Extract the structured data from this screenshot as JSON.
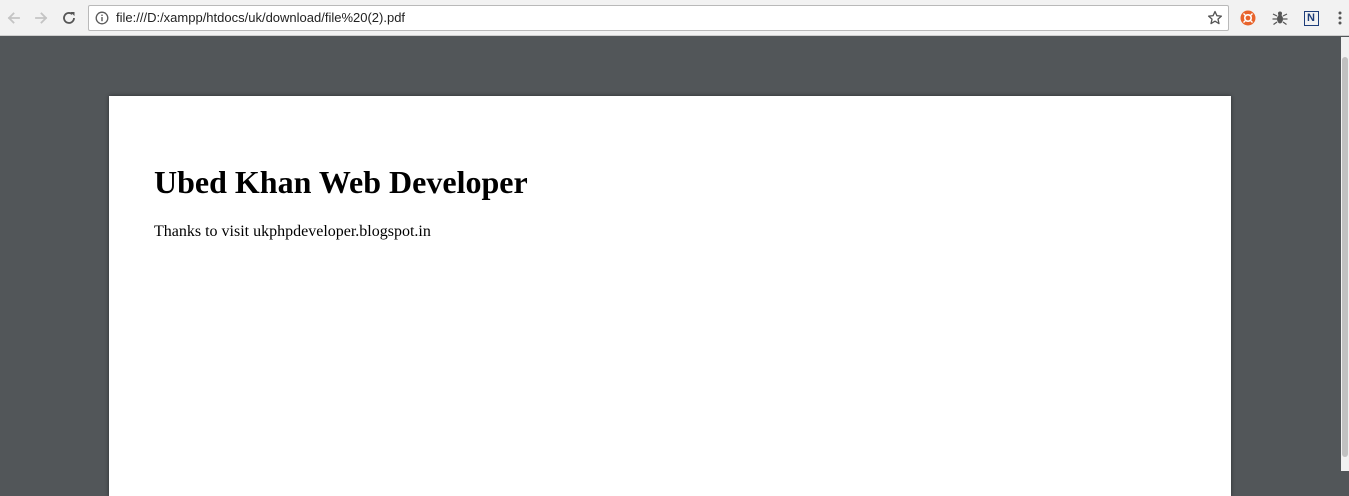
{
  "browser": {
    "url": "file:///D:/xampp/htdocs/uk/download/file%20(2).pdf",
    "icons": {
      "back": "arrow-left-icon",
      "forward": "arrow-right-icon",
      "reload": "reload-icon",
      "site_info": "info-icon",
      "bookmark": "star-icon",
      "extension_1": "orange-extension-icon",
      "extension_2": "bug-extension-icon",
      "extension_3": "n-extension-icon",
      "menu": "kebab-menu-icon"
    },
    "extension_3_label": "N"
  },
  "document": {
    "title": "Ubed Khan Web Developer",
    "body": "Thanks to visit ukphpdeveloper.blogspot.in"
  },
  "colors": {
    "viewer_background": "#525659",
    "toolbar_background": "#f2f2f2",
    "page_background": "#ffffff",
    "extension_orange": "#e8632b"
  }
}
